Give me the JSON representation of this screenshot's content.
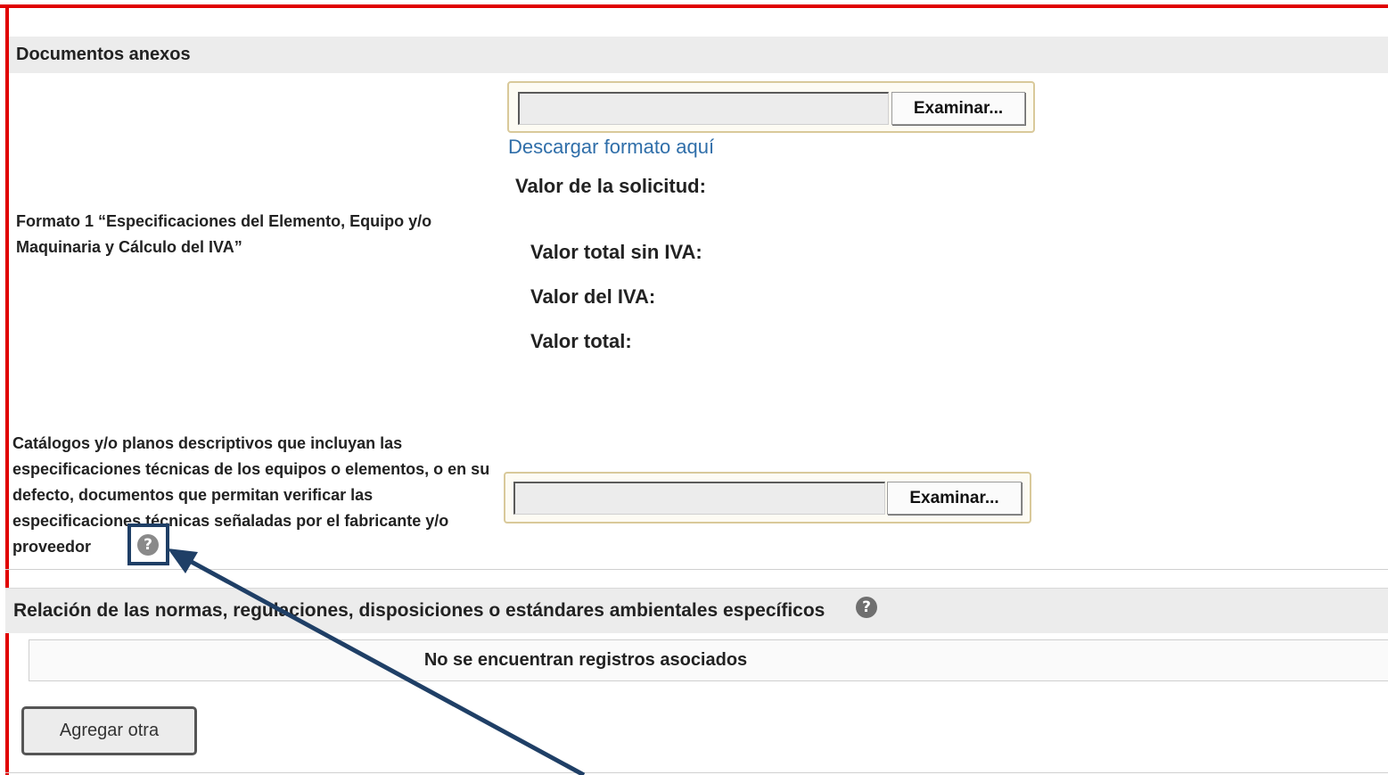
{
  "documentos": {
    "header": "Documentos anexos",
    "formato_label": "Formato 1 “Especificaciones del Elemento, Equipo y/o Maquinaria y Cálculo del IVA”",
    "browse_label": "Examinar...",
    "download_link": "Descargar formato aquí",
    "valor_solicitud": "Valor de la solicitud:",
    "valor_sin_iva": "Valor total sin IVA:",
    "valor_iva": "Valor del IVA:",
    "valor_total": "Valor total:",
    "catalogos_label": "Catálogos y/o planos descriptivos que incluyan las especificaciones técnicas de los equipos o elementos, o en su defecto, documentos que permitan verificar las especificaciones técnicas señaladas por el fabricante y/o proveedor",
    "browse_label_2": "Examinar..."
  },
  "normas": {
    "header": "Relación de las normas, regulaciones, disposiciones o estándares ambientales específicos",
    "empty_message": "No se encuentran registros asociados",
    "add_button": "Agregar otra"
  },
  "icons": {
    "help": "help-icon",
    "help_glyph": "?"
  },
  "colors": {
    "frame": "#e00000",
    "annotation": "#1f3f66",
    "link": "#2f6ea9",
    "file_border": "#d9c99a"
  }
}
